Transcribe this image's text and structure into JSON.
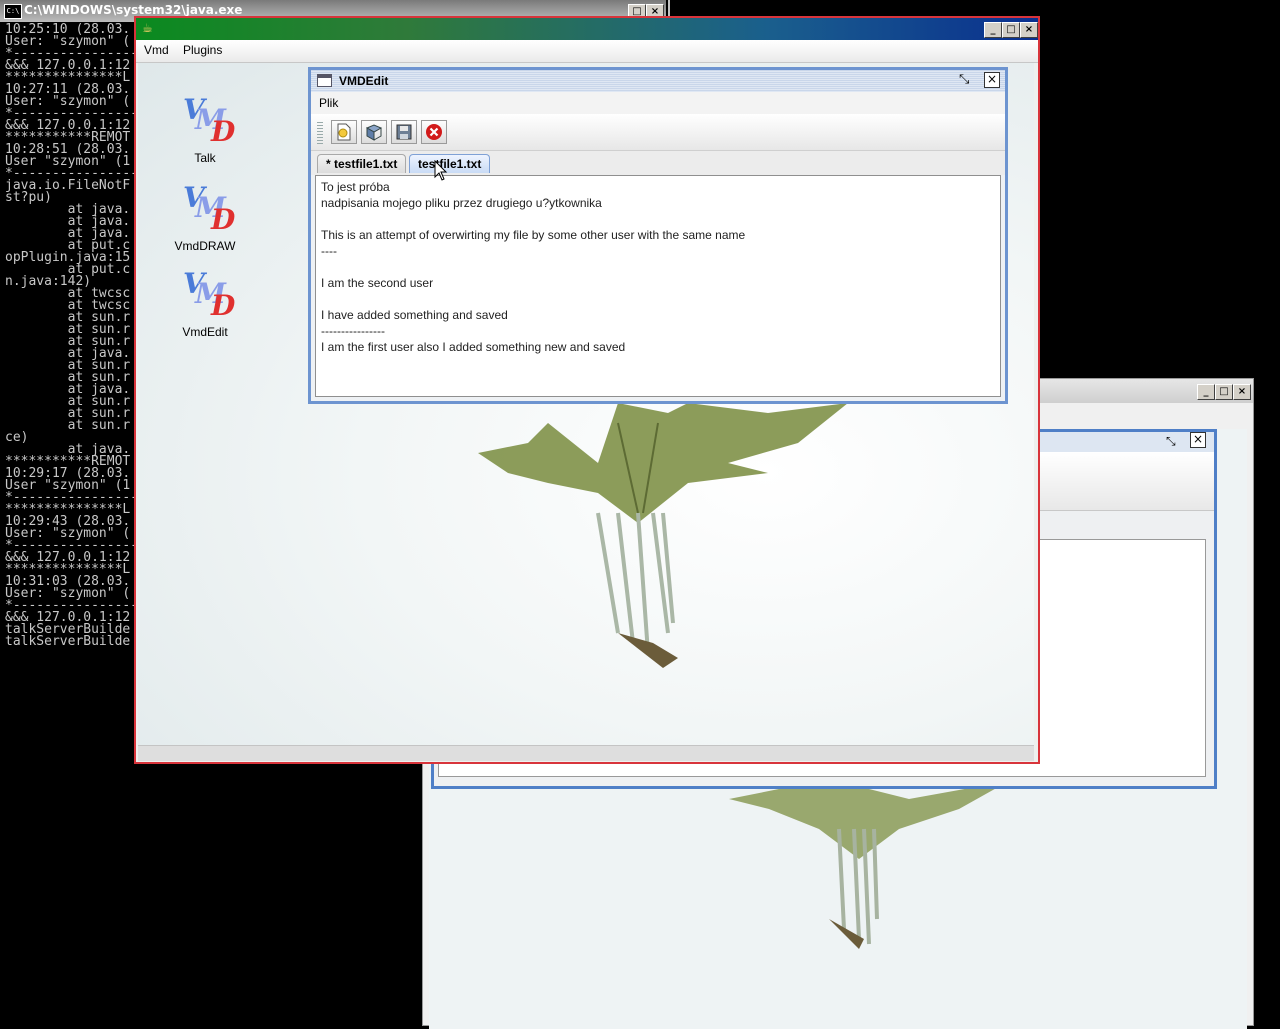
{
  "console": {
    "title": "C:\\WINDOWS\\system32\\java.exe",
    "lines": [
      "10:25:10 (28.03.",
      "User: \"szymon\" (",
      "*-----------------",
      "&&& 127.0.0.1:12",
      "***************L",
      "10:27:11 (28.03.",
      "User: \"szymon\" (",
      "*-----------------",
      "&&& 127.0.0.1:12",
      "***********REMOT",
      "10:28:51 (28.03.",
      "User \"szymon\" (1",
      "*-----------------",
      "java.io.FileNotF",
      "st?pu)",
      "        at java.",
      "        at java.",
      "        at java.",
      "        at put.c",
      "opPlugin.java:15",
      "        at put.c",
      "n.java:142)",
      "        at twcsc",
      "        at twcsc",
      "        at sun.r",
      "        at sun.r",
      "        at sun.r",
      "        at java.",
      "        at sun.r",
      "        at sun.r",
      "        at java.",
      "        at sun.r",
      "        at sun.r",
      "        at sun.r",
      "ce)",
      "        at java.",
      "***********REMOT",
      "10:29:17 (28.03.",
      "User \"szymon\" (1",
      "*-----------------",
      "***************L",
      "10:29:43 (28.03.",
      "User: \"szymon\" (",
      "*-----------------",
      "&&& 127.0.0.1:12",
      "***************L",
      "10:31:03 (28.03.",
      "User: \"szymon\" (",
      "*-----------------",
      "&&& 127.0.0.1:12",
      "talkServerBuilde",
      "talkServerBuilde"
    ]
  },
  "main_window": {
    "menu": [
      "Vmd",
      "Plugins"
    ],
    "desktop_icons": [
      {
        "label": "Talk",
        "icon": "vmd-logo-icon"
      },
      {
        "label": "VmdDRAW",
        "icon": "vmd-logo-icon"
      },
      {
        "label": "VmdEdit",
        "icon": "vmd-logo-icon"
      }
    ]
  },
  "editor": {
    "title": "VMDEdit",
    "menu": [
      "Plik"
    ],
    "toolbar": [
      {
        "name": "new-file",
        "icon": "new-file-icon"
      },
      {
        "name": "open-file",
        "icon": "open-file-icon"
      },
      {
        "name": "save-file",
        "icon": "save-icon"
      },
      {
        "name": "close-file",
        "icon": "close-circle-icon"
      }
    ],
    "tabs": [
      {
        "label": "* testfile1.txt",
        "active": false
      },
      {
        "label": "testfile1.txt",
        "active": true
      }
    ],
    "content_lines": [
      "To jest próba",
      "nadpisania mojego pliku przez drugiego u?ytkownika",
      "",
      "This is an attempt of overwirting my file by some other user with the same name",
      "----",
      "",
      "I am the second user",
      "",
      "I have added something and saved",
      "----------------",
      "I am the first user also I added something new and saved"
    ]
  },
  "colors": {
    "main_border": "#d8343b",
    "titlebar_green": "#0a8a1f",
    "titlebar_blue": "#0a2f8f",
    "internal_frame_border": "#6d94d0",
    "close_button_red": "#d21a1a"
  }
}
